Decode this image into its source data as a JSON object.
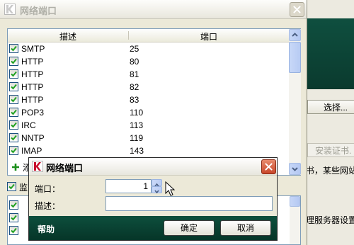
{
  "main_window": {
    "title": "网络端口",
    "columns": [
      "描述",
      "端口"
    ],
    "rows": [
      {
        "name": "SMTP",
        "port": "25",
        "checked": true
      },
      {
        "name": "HTTP",
        "port": "80",
        "checked": true
      },
      {
        "name": "HTTP",
        "port": "81",
        "checked": true
      },
      {
        "name": "HTTP",
        "port": "82",
        "checked": true
      },
      {
        "name": "HTTP",
        "port": "83",
        "checked": true
      },
      {
        "name": "POP3",
        "port": "110",
        "checked": true
      },
      {
        "name": "IRC",
        "port": "113",
        "checked": true
      },
      {
        "name": "NNTP",
        "port": "119",
        "checked": true
      },
      {
        "name": "IMAP",
        "port": "143",
        "checked": true
      }
    ],
    "add_label": "添",
    "monitor_label": "监"
  },
  "background_app": {
    "select_button": "选择...",
    "install_cert_button": "安装证书.",
    "text_line1": "书，某些网站",
    "text_line2": "理服务器设置"
  },
  "dialog": {
    "title": "网络端口",
    "port_label": "端口：",
    "port_value": "1",
    "desc_label": "描述：",
    "desc_value": "",
    "help_link": "帮助",
    "ok_button": "确定",
    "cancel_button": "取消"
  },
  "colors": {
    "footer_green": "#0d4f3d",
    "list_border": "#7f9db9",
    "checkbox_check": "#21a121"
  }
}
